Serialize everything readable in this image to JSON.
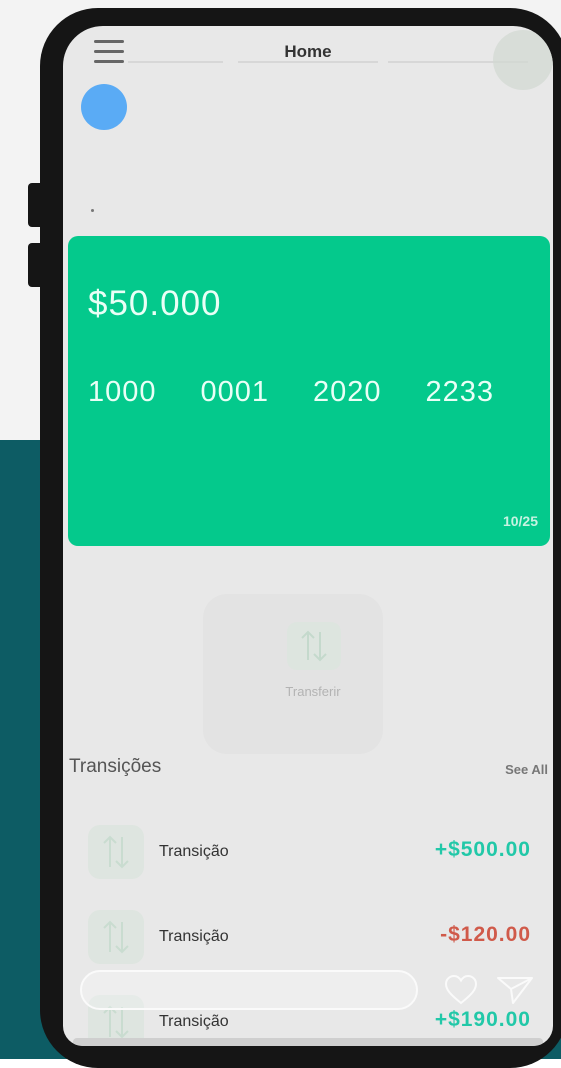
{
  "header": {
    "title": "Home"
  },
  "card": {
    "balance": "$50.000",
    "number_groups": [
      "1000",
      "0001",
      "2020",
      "2233"
    ],
    "expiry": "10/25",
    "color": "#04c98c"
  },
  "actions": {
    "transfer_label": "Transferir"
  },
  "transactions": {
    "title": "Transições",
    "see_all": "See All",
    "items": [
      {
        "name": "Transição",
        "amount": "+$500.00"
      },
      {
        "name": "Transição",
        "amount": "-$120.00"
      },
      {
        "name": "Transição",
        "amount": "+$190.00"
      }
    ]
  },
  "icons": {
    "menu": "hamburger-menu-icon",
    "transfer": "arrows-up-down-icon",
    "heart": "heart-outline-icon",
    "send": "paper-plane-icon"
  }
}
